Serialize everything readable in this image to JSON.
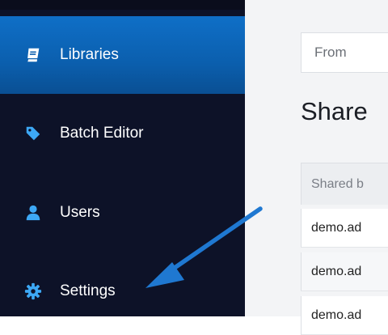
{
  "sidebar": {
    "items": [
      {
        "label": "Libraries",
        "icon": "book-icon",
        "active": true
      },
      {
        "label": "Batch Editor",
        "icon": "tag-icon",
        "active": false
      },
      {
        "label": "Users",
        "icon": "user-icon",
        "active": false
      },
      {
        "label": "Settings",
        "icon": "gear-icon",
        "active": false
      }
    ]
  },
  "main": {
    "from_field": {
      "placeholder": "From"
    },
    "heading": "Share",
    "table": {
      "header": "Shared b",
      "rows": [
        "demo.ad",
        "demo.ad",
        "demo.ad"
      ]
    }
  },
  "annotation": {
    "icon": "arrow-pointer-icon",
    "color": "#1f78d1"
  },
  "colors": {
    "sidebar_bg": "#0d1228",
    "active_bg": "#0b63b8",
    "content_bg": "#f3f4f6",
    "icon_blue": "#3da8f5"
  }
}
